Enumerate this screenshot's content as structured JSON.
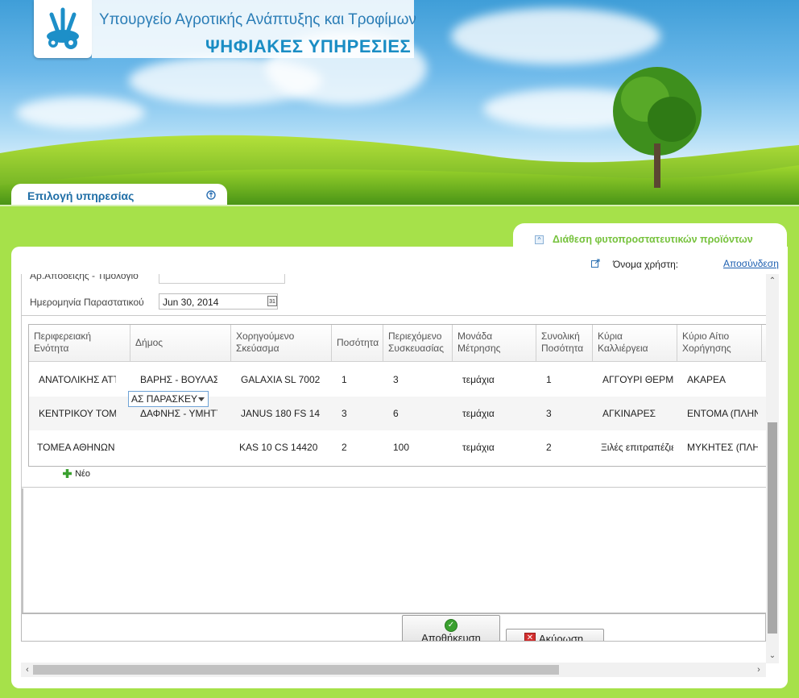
{
  "header": {
    "ministry": "Υπουργείο Αγροτικής Ανάπτυξης και Τροφίμων",
    "digital_services": "ΨΗΦΙΑΚΕΣ ΥΠΗΡΕΣΙΕΣ",
    "service_selection": "Επιλογή υπηρεσίας"
  },
  "panel": {
    "title": "Διάθεση φυτοπροστατευτικών προϊόντων",
    "username_label": "Όνομα χρήστη:",
    "logout": "Αποσύνδεση"
  },
  "form": {
    "partial_label": "Αρ.Απόδειξης - Τιμολόγιο",
    "date_label": "Ημερομηνία Παραστατικού",
    "date_value": "Jun 30, 2014"
  },
  "grid": {
    "headers": [
      "Περιφερειακή Ενότητα",
      "Δήμος",
      "Χορηγούμενο Σκεύασμα",
      "Ποσότητα",
      "Περιεχόμενο Συσκευασίας",
      "Μονάδα Μέτρησης",
      "Συνολική Ποσότητα",
      "Κύρια Καλλιέργεια",
      "Κύριο Αίτιο Χορήγησης"
    ],
    "rows": [
      [
        "ΑΝΑΤΟΛΙΚΗΣ ΑΤΤ",
        "ΒΑΡΗΣ - ΒΟΥΛΑΣ",
        "GALAXIA SL 7002",
        "1",
        "3",
        "τεμάχια",
        "1",
        "ΑΓΓΟΥΡΙ ΘΕΡΜΟ",
        "ΑΚΑΡΕΑ"
      ],
      [
        "ΚΕΝΤΡΙΚΟΥ ΤΟΜ",
        "ΔΑΦΝΗΣ - ΥΜΗΤΤ",
        "JANUS 180 FS 14",
        "3",
        "6",
        "τεμάχια",
        "3",
        "ΑΓΚΙΝΑΡΕΣ",
        "ΕΝΤΟΜΑ (ΠΛΗΝ"
      ],
      [
        "ΤΟΜΕΑ ΑΘΗΝΩΝ",
        "ΑΣ ΠΑΡΑΣΚΕΥ",
        "KAS 10 CS 14420",
        "2",
        "100",
        "τεμάχια",
        "2",
        "Ξιλές επιτραπέζιε",
        "ΜΥΚΗΤΕΣ (ΠΛΗ"
      ]
    ],
    "new_label": "Νέο"
  },
  "buttons": {
    "save": "Αποθήκευση",
    "cancel": "Ακύρωση"
  },
  "colors": {
    "page_green": "#a6e14a",
    "link_blue": "#1d5fb0",
    "tab_green_text": "#76c23c"
  }
}
